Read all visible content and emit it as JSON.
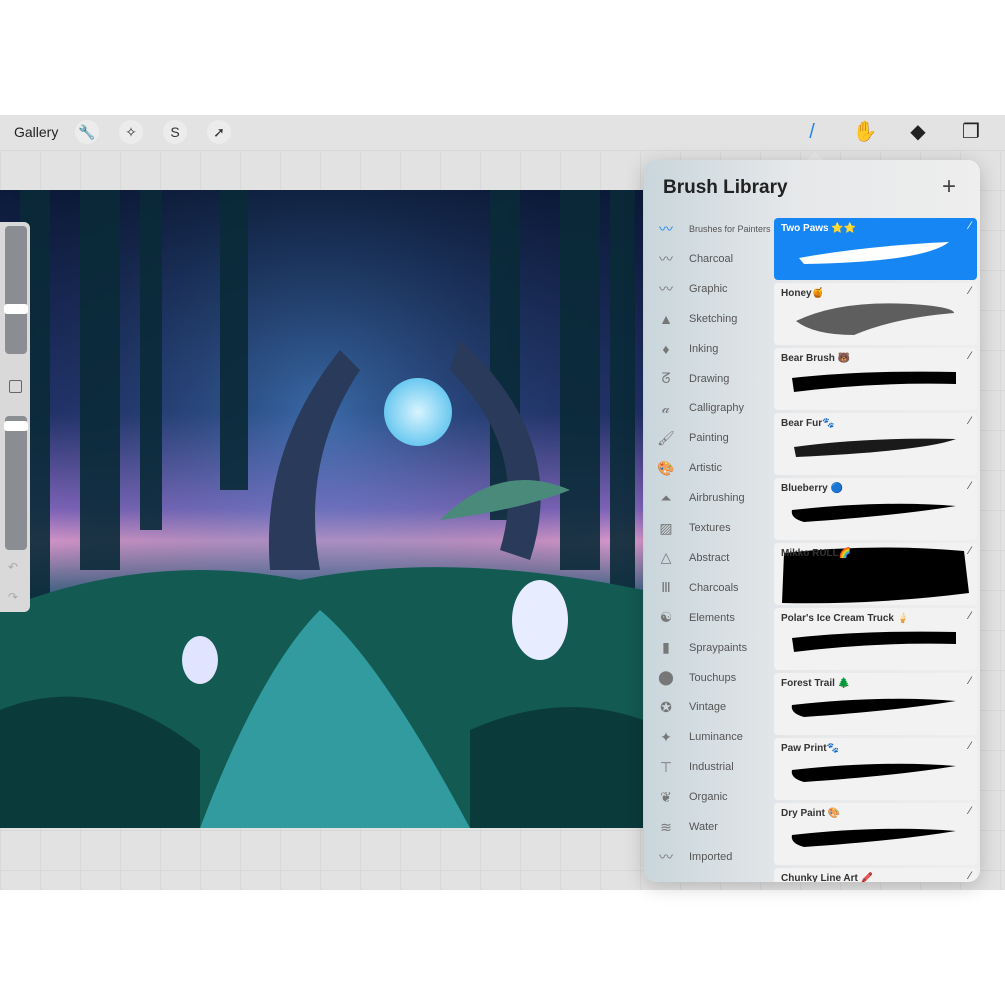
{
  "toolbar": {
    "gallery": "Gallery",
    "left_tools": [
      {
        "icon": "wrench-icon",
        "glyph": "🔧"
      },
      {
        "icon": "magic-wand-icon",
        "glyph": "✧"
      },
      {
        "icon": "selection-icon",
        "glyph": "S"
      },
      {
        "icon": "transform-arrow-icon",
        "glyph": "➚"
      }
    ],
    "right_tools": [
      {
        "icon": "brush-icon",
        "glyph": "/",
        "color": "#1b86f2"
      },
      {
        "icon": "smudge-icon",
        "glyph": "✋"
      },
      {
        "icon": "eraser-icon",
        "glyph": "◆"
      },
      {
        "icon": "layers-icon",
        "glyph": "❐"
      }
    ]
  },
  "brush_library": {
    "title": "Brush Library",
    "add": "+",
    "categories": [
      {
        "label": "Brushes for Painters",
        "icon": "brush-stroke-icon",
        "glyph": "〰",
        "selected": true
      },
      {
        "label": "Charcoal",
        "icon": "brush-stroke-icon",
        "glyph": "〰"
      },
      {
        "label": "Graphic",
        "icon": "brush-stroke-icon",
        "glyph": "〰"
      },
      {
        "label": "Sketching",
        "icon": "pencil-tip-icon",
        "glyph": "▲"
      },
      {
        "label": "Inking",
        "icon": "pen-nib-icon",
        "glyph": "♦"
      },
      {
        "label": "Drawing",
        "icon": "squiggle-icon",
        "glyph": "ᘔ"
      },
      {
        "label": "Calligraphy",
        "icon": "calligraphy-icon",
        "glyph": "𝒶"
      },
      {
        "label": "Painting",
        "icon": "paintbrush-icon",
        "glyph": "🖌"
      },
      {
        "label": "Artistic",
        "icon": "palette-icon",
        "glyph": "🎨"
      },
      {
        "label": "Airbrushing",
        "icon": "airbrush-icon",
        "glyph": "⏶"
      },
      {
        "label": "Textures",
        "icon": "texture-icon",
        "glyph": "▨"
      },
      {
        "label": "Abstract",
        "icon": "triangle-icon",
        "glyph": "△"
      },
      {
        "label": "Charcoals",
        "icon": "charcoal-sticks-icon",
        "glyph": "Ⅲ"
      },
      {
        "label": "Elements",
        "icon": "yin-yang-icon",
        "glyph": "☯"
      },
      {
        "label": "Spraypaints",
        "icon": "spray-can-icon",
        "glyph": "▮"
      },
      {
        "label": "Touchups",
        "icon": "touchup-icon",
        "glyph": "⬤"
      },
      {
        "label": "Vintage",
        "icon": "star-circle-icon",
        "glyph": "✪"
      },
      {
        "label": "Luminance",
        "icon": "sparkle-icon",
        "glyph": "✦"
      },
      {
        "label": "Industrial",
        "icon": "anvil-icon",
        "glyph": "⊤"
      },
      {
        "label": "Organic",
        "icon": "leaf-icon",
        "glyph": "❦"
      },
      {
        "label": "Water",
        "icon": "waves-icon",
        "glyph": "≋"
      },
      {
        "label": "Imported",
        "icon": "brush-stroke-icon",
        "glyph": "〰"
      }
    ],
    "brushes": [
      {
        "name": "Two Paws ⭐⭐",
        "selected": true,
        "stroke": "soft"
      },
      {
        "name": "Honey🍯",
        "stroke": "grain"
      },
      {
        "name": "Bear Brush 🐻",
        "stroke": "rough"
      },
      {
        "name": "Bear Fur🐾",
        "stroke": "fur"
      },
      {
        "name": "Blueberry 🔵",
        "stroke": "taper"
      },
      {
        "name": "Mikko RULL🌈",
        "stroke": "block"
      },
      {
        "name": "Polar's Ice Cream Truck 🍦",
        "stroke": "rough"
      },
      {
        "name": "Forest Trail 🌲",
        "stroke": "taper"
      },
      {
        "name": "Paw Print🐾",
        "stroke": "taper"
      },
      {
        "name": "Dry Paint 🎨",
        "stroke": "taper"
      },
      {
        "name": "Chunky Line Art 🖍️",
        "stroke": "taper"
      }
    ]
  },
  "colors": {
    "accent": "#1686f5"
  }
}
